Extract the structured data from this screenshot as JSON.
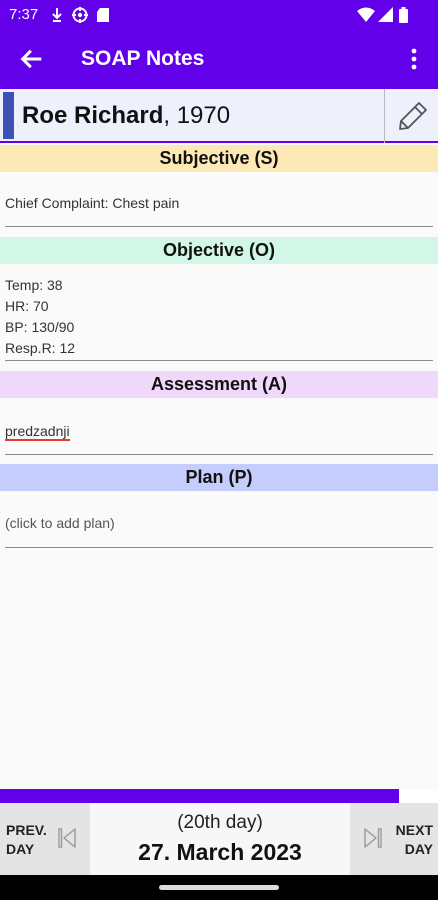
{
  "status_bar": {
    "time": "7:37",
    "icons": [
      "download-icon",
      "target-icon",
      "sd-card-icon",
      "wifi-icon",
      "signal-icon",
      "battery-icon"
    ]
  },
  "app_bar": {
    "title": "SOAP Notes"
  },
  "patient": {
    "last_first": "Roe Richard",
    "year_suffix": ", 1970"
  },
  "sections": {
    "subjective": {
      "header": "Subjective (S)",
      "lines": [
        "Chief Complaint: Chest pain"
      ],
      "color": "#fde9b6"
    },
    "objective": {
      "header": "Objective (O)",
      "lines": [
        "Temp: 38",
        "HR: 70",
        "BP: 130/90",
        "Resp.R: 12"
      ],
      "color": "#d2f7e7"
    },
    "assessment": {
      "header": "Assessment (A)",
      "lines": [
        "predzadnji"
      ],
      "color": "#efd8fa"
    },
    "plan": {
      "header": "Plan (P)",
      "lines": [
        "(click to add plan)"
      ],
      "color": "#c4cdfb"
    }
  },
  "progress": {
    "fraction": 0.91
  },
  "footer": {
    "prev_label_1": "PREV.",
    "prev_label_2": "DAY",
    "next_label_1": "NEXT",
    "next_label_2": "DAY",
    "day_number": "(20th day)",
    "date": "27. March 2023"
  },
  "colors": {
    "primary": "#6200ea",
    "accent": "#3f51b5"
  }
}
